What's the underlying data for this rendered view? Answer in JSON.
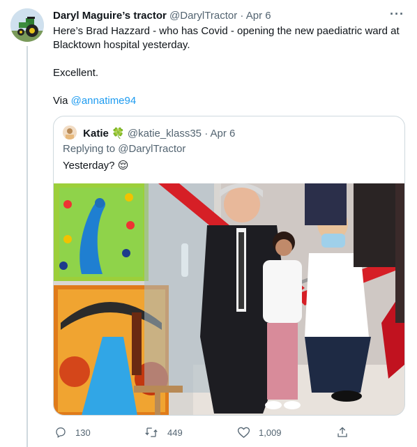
{
  "tweet": {
    "author_name": "Daryl Maguire’s tractor",
    "author_handle": "@DarylTractor",
    "separator": "·",
    "date": "Apr 6",
    "more_label": "···",
    "text_line1": "Here’s Brad Hazzard - who has Covid - opening the new paediatric ward at Blacktown hospital yesterday.",
    "text_line2": "Excellent.",
    "via_label": "Via",
    "via_mention": "@annatime94"
  },
  "quote": {
    "author_name": "Katie",
    "author_emoji": "🍀",
    "author_handle": "@katie_klass35",
    "separator": "·",
    "date": "Apr 6",
    "replying_label": "Replying to",
    "replying_handle": "@DarylTractor",
    "text": "Yesterday?",
    "text_emoji": "😌"
  },
  "actions": {
    "reply_count": "130",
    "retweet_count": "449",
    "like_count": "1,009"
  },
  "colors": {
    "accent": "#1d9bf0",
    "muted": "#536471",
    "border": "#cfd9de"
  },
  "icons": [
    "reply-icon",
    "retweet-icon",
    "like-icon",
    "share-icon",
    "more-icon"
  ]
}
